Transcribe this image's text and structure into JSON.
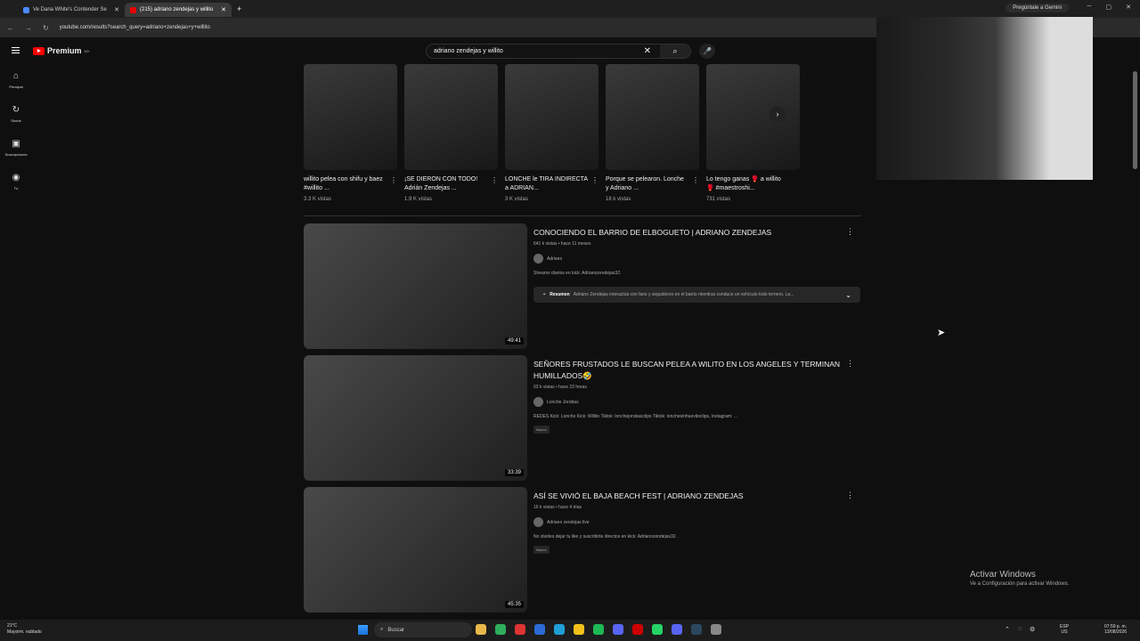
{
  "browser": {
    "tabs": [
      {
        "label": "Ve Dana White's Contender Se"
      },
      {
        "label": "(215) adriano zendejas y willito"
      }
    ],
    "url": "youtube.com/results?search_query=adriano+zendejas+y+willito",
    "gemini": "Pregúntale a Gemini"
  },
  "youtube": {
    "logo": "Premium",
    "logo_region": "MX",
    "search_query": "adriano zendejas y willito",
    "sidebar": [
      {
        "label": "Principal",
        "icon": "⌂"
      },
      {
        "label": "Shorts",
        "icon": "↻"
      },
      {
        "label": "Suscripciones",
        "icon": "▣"
      },
      {
        "label": "Tú",
        "icon": "◉"
      }
    ]
  },
  "shorts": [
    {
      "title": "willito pelea con shifu y baez #willito ...",
      "views": "3.3 K vistas"
    },
    {
      "title": "¡SE DIERON CON TODO! Adrián Zendejas ...",
      "views": "1.9 K vistas"
    },
    {
      "title": "LONCHE le TIRA INDIRECTA a ADRIAN...",
      "views": "3 K vistas"
    },
    {
      "title": "Porque se pelearon. Lonche y Adriano ...",
      "views": "18 k vistas"
    },
    {
      "title": "Lo tengo ganas 🥊 a willito 🥊 #maestroshi...",
      "views": "731 vistas"
    }
  ],
  "videos": [
    {
      "title": "CONOCIENDO EL BARRIO DE ELBOGUETO | ADRIANO ZENDEJAS",
      "meta": "641 k vistas • hace 11 meses",
      "channel": "Adriano",
      "desc": "Streams diarios en kick: Adrianozendejas32.",
      "duration": "49:41",
      "summary_label": "Resumen",
      "summary": "Adriano Zendejas interactúa con fans y seguidores en el barrio mientras conduce un vehículo todo terreno. La..."
    },
    {
      "title": "SEÑORES FRUSTADOS LE BUSCAN PELEA A WILITO EN LOS ANGELES Y TERMINAN HUMILLADOS🤣",
      "meta": "93 k vistas • hace 23 horas",
      "channel": "Lonche Jorobas",
      "desc": "REDES Kick: Lonche Kick: Willito Tiktok: lonchejorobasclips Tiktok: lonchesinhuevitoclips, Instagram: ...",
      "duration": "33:39",
      "badge": "Nuevo"
    },
    {
      "title": "ASÍ SE VIVIÓ EL BAJA BEACH FEST | ADRIANO ZENDEJAS",
      "meta": "16 k vistas • hace 4 días",
      "channel": "Adriano zendejas live",
      "desc": "No olvides dejar tu like y suscribirte directos en kick: Adrianozendejas32.",
      "duration": "45:35",
      "badge": "Nuevo"
    }
  ],
  "windows": {
    "activate_title": "Activar Windows",
    "activate_sub": "Ve a Configuración para activar Windows.",
    "weather_temp": "21°C",
    "weather_desc": "Mayorm. nublado",
    "search": "Buscar",
    "lang1": "ESP",
    "lang2": "US",
    "time": "07:59 p. m.",
    "date": "13/08/2026"
  }
}
